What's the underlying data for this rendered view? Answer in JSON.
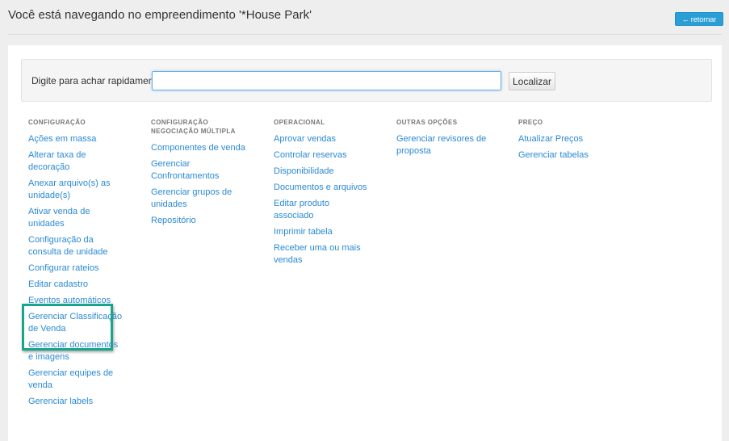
{
  "header": {
    "title": "Você está navegando no empreendimento '*House Park'",
    "back_icon": "arrow-left-icon",
    "back_label": "retornar"
  },
  "search": {
    "label": "Digite para achar rapidamente:",
    "value": "",
    "placeholder": "",
    "button_label": "Localizar"
  },
  "columns": [
    {
      "heading": "CONFIGURAÇÃO",
      "items": [
        "Ações em massa",
        "Alterar taxa de decoração",
        "Anexar arquivo(s) as unidade(s)",
        "Ativar venda de unidades",
        "Configuração da consulta de unidade",
        "Configurar rateios",
        "Editar cadastro",
        "Eventos automáticos",
        "Gerenciar Classificação de Venda",
        "Gerenciar documentos e imagens",
        "Gerenciar equipes de venda",
        "Gerenciar labels"
      ]
    },
    {
      "heading": "CONFIGURAÇÃO NEGOCIAÇÃO MÚLTIPLA",
      "items": [
        "Componentes de venda",
        "Gerenciar Confrontamentos",
        "Gerenciar grupos de unidades",
        "Repositório"
      ]
    },
    {
      "heading": "OPERACIONAL",
      "items": [
        "Aprovar vendas",
        "Controlar reservas",
        "Disponibilidade",
        "Documentos e arquivos",
        "Editar produto associado",
        "Imprimir tabela",
        "Receber uma ou mais vendas"
      ]
    },
    {
      "heading": "OUTRAS OPÇÕES",
      "items": [
        "Gerenciar revisores de proposta"
      ]
    },
    {
      "heading": "PREÇO",
      "items": [
        "Atualizar Preços",
        "Gerenciar tabelas"
      ]
    }
  ],
  "colors": {
    "link": "#2a8ad4",
    "accent": "#2a9fd6",
    "highlight": "#18a58c",
    "background": "#eeeeee"
  }
}
